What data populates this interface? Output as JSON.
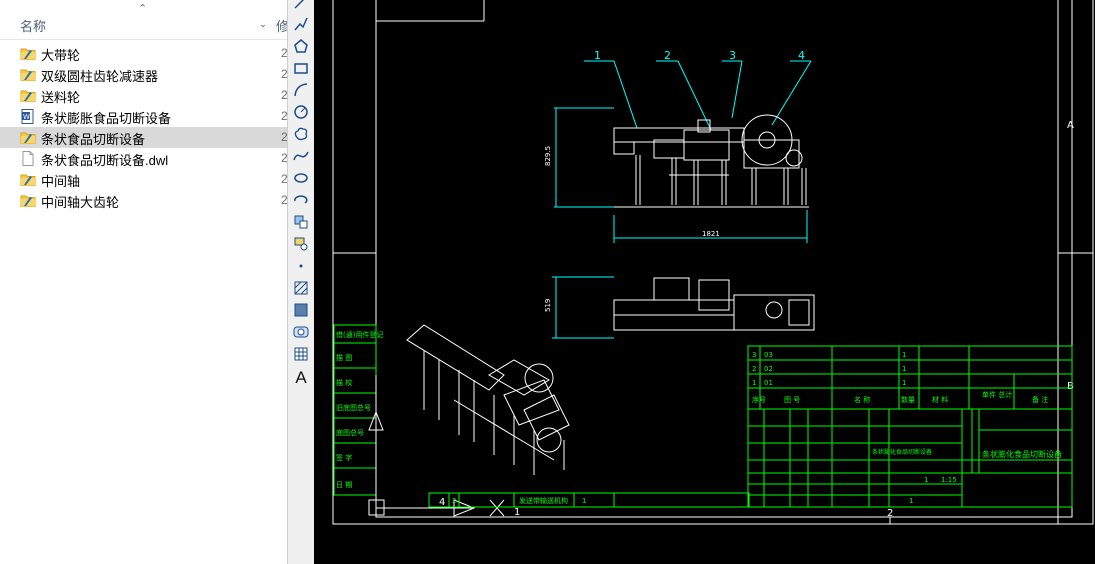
{
  "explorer": {
    "header": {
      "name_label": "名称",
      "next_col_label": "修"
    },
    "items": [
      {
        "name": "大带轮",
        "type": "folder",
        "date": "2"
      },
      {
        "name": "双级圆柱齿轮减速器",
        "type": "folder",
        "date": "2"
      },
      {
        "name": "送料轮",
        "type": "folder",
        "date": "2"
      },
      {
        "name": "条状膨胀食品切断设备",
        "type": "word-doc",
        "date": "2"
      },
      {
        "name": "条状食品切断设备",
        "type": "folder",
        "date": "2",
        "selected": true
      },
      {
        "name": "条状食品切断设备.dwl",
        "type": "file",
        "date": "2"
      },
      {
        "name": "中间轴",
        "type": "folder",
        "date": "2"
      },
      {
        "name": "中间轴大齿轮",
        "type": "folder",
        "date": "2"
      }
    ]
  },
  "toolbar": {
    "tools": [
      "line-icon",
      "polyline-icon",
      "polygon-icon",
      "rectangle-icon",
      "arc-icon",
      "circle-icon",
      "revision-cloud-icon",
      "spline-icon",
      "ellipse-icon",
      "ellipse-arc-icon",
      "insert-block-icon",
      "make-block-icon",
      "point-icon",
      "hatch-icon",
      "gradient-icon",
      "region-icon",
      "table-icon",
      "multiline-text-icon"
    ],
    "text_tool_label": "A"
  },
  "drawing": {
    "balloons": [
      "1",
      "2",
      "3",
      "4"
    ],
    "dim_height": "829.5",
    "dim_width": "1821",
    "dim_plan_height": "519",
    "zone_labels": {
      "right_a": "A",
      "right_b": "B",
      "bottom_1": "1",
      "bottom_2": "2",
      "bottom_4": "4"
    },
    "bom_rows": [
      {
        "no": "3",
        "code": "03",
        "qty": "1"
      },
      {
        "no": "2",
        "code": "02",
        "qty": "1"
      },
      {
        "no": "1",
        "code": "01",
        "qty": "1"
      }
    ],
    "bom_header": {
      "seq": "序号",
      "code": "图 号",
      "name": "名 称",
      "qty": "数量",
      "material": "材 料",
      "weight": "单件 总计",
      "note": "备 注"
    },
    "title_block": {
      "drawing_title": "条状膨化食品切断设备",
      "scale": "1:15",
      "sheet_1": "1",
      "sheet_2": "1"
    },
    "side_table_labels": [
      "借(通)用件登记",
      "描 图",
      "描 校",
      "旧底图总号",
      "底图总号",
      "签 字",
      "日 期"
    ]
  },
  "colors": {
    "cad_background": "#000000",
    "frame_line": "#ffffff",
    "table_line": "#00ff00",
    "dim_line": "#00ffff",
    "selection": "#d9d9d9",
    "folder": "#f8c940"
  }
}
